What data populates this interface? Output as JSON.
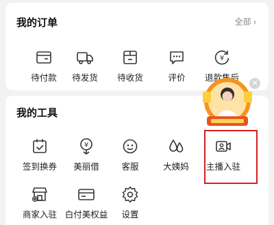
{
  "orders": {
    "title": "我的订单",
    "all_label": "全部 ›",
    "items": [
      {
        "label": "待付款",
        "icon": "wallet-icon"
      },
      {
        "label": "待发货",
        "icon": "truck-icon"
      },
      {
        "label": "待收货",
        "icon": "package-icon"
      },
      {
        "label": "评价",
        "icon": "comment-icon"
      },
      {
        "label": "退款售后",
        "icon": "refund-icon"
      }
    ]
  },
  "tools": {
    "title": "我的工具",
    "items": [
      {
        "label": "签到换券",
        "icon": "calendar-check-icon"
      },
      {
        "label": "美丽借",
        "icon": "yen-flower-icon"
      },
      {
        "label": "客服",
        "icon": "service-face-icon"
      },
      {
        "label": "大姨妈",
        "icon": "drops-icon"
      },
      {
        "label": "主播入驻",
        "icon": "camera-add-icon"
      },
      {
        "label": "商家入驻",
        "icon": "shop-icon"
      },
      {
        "label": "白付美权益",
        "icon": "card-icon"
      },
      {
        "label": "设置",
        "icon": "gear-icon"
      }
    ]
  },
  "promo": {
    "icon": "live-streamer-promo-icon",
    "close_icon": "close-icon"
  },
  "colors": {
    "highlight": "#d21f1f",
    "promo_orange": "#f7931e"
  }
}
